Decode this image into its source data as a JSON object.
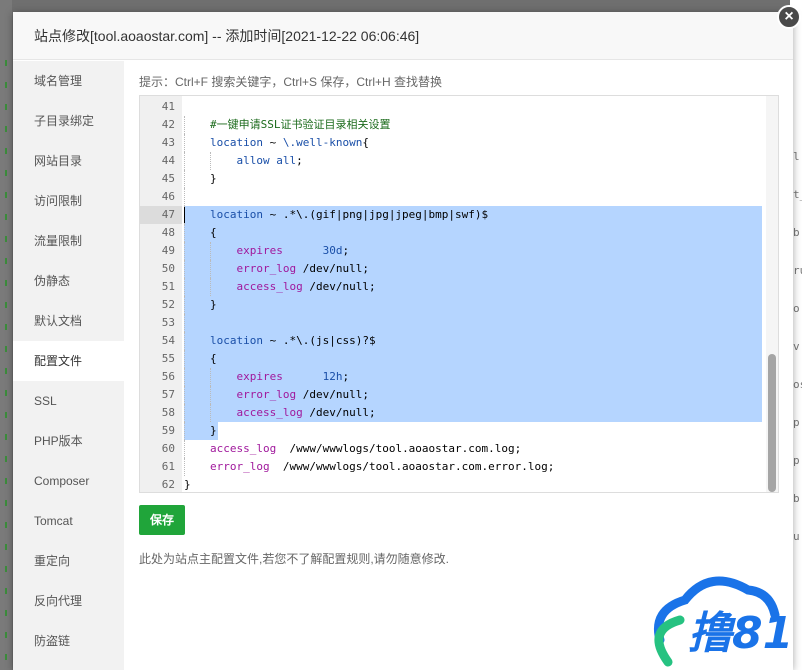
{
  "dialog": {
    "title": "站点修改[tool.aoaostar.com] -- 添加时间[2021-12-22 06:06:46]",
    "close_label": "×"
  },
  "sidebar": {
    "items": [
      {
        "label": "域名管理",
        "active": false
      },
      {
        "label": "子目录绑定",
        "active": false
      },
      {
        "label": "网站目录",
        "active": false
      },
      {
        "label": "访问限制",
        "active": false
      },
      {
        "label": "流量限制",
        "active": false
      },
      {
        "label": "伪静态",
        "active": false
      },
      {
        "label": "默认文档",
        "active": false
      },
      {
        "label": "配置文件",
        "active": true
      },
      {
        "label": "SSL",
        "active": false
      },
      {
        "label": "PHP版本",
        "active": false
      },
      {
        "label": "Composer",
        "active": false
      },
      {
        "label": "Tomcat",
        "active": false
      },
      {
        "label": "重定向",
        "active": false
      },
      {
        "label": "反向代理",
        "active": false
      },
      {
        "label": "防盗链",
        "active": false
      }
    ]
  },
  "editor": {
    "hint": "提示：Ctrl+F 搜索关键字，Ctrl+S 保存，Ctrl+H 查找替换",
    "current_line": 47,
    "selection": {
      "from": 47,
      "to": 59
    },
    "lines": [
      {
        "n": "41",
        "text": ""
      },
      {
        "n": "42",
        "text": "#一键申请SSL证书验证目录相关设置"
      },
      {
        "n": "43",
        "text": "location ~ \\.well-known{"
      },
      {
        "n": "44",
        "text": "    allow all;"
      },
      {
        "n": "45",
        "text": "}"
      },
      {
        "n": "46",
        "text": ""
      },
      {
        "n": "47",
        "text": "location ~ .*\\.(gif|png|jpg|jpeg|bmp|swf)$"
      },
      {
        "n": "48",
        "text": "{"
      },
      {
        "n": "49",
        "text": "    expires      30d;"
      },
      {
        "n": "50",
        "text": "    error_log /dev/null;"
      },
      {
        "n": "51",
        "text": "    access_log /dev/null;"
      },
      {
        "n": "52",
        "text": "}"
      },
      {
        "n": "53",
        "text": ""
      },
      {
        "n": "54",
        "text": "location ~ .*\\.(js|css)?$"
      },
      {
        "n": "55",
        "text": "{"
      },
      {
        "n": "56",
        "text": "    expires      12h;"
      },
      {
        "n": "57",
        "text": "    error_log /dev/null;"
      },
      {
        "n": "58",
        "text": "    access_log /dev/null;"
      },
      {
        "n": "59",
        "text": "}"
      },
      {
        "n": "60",
        "text": "access_log  /www/wwwlogs/tool.aoaostar.com.log;"
      },
      {
        "n": "61",
        "text": "error_log  /www/wwwlogs/tool.aoaostar.com.error.log;"
      },
      {
        "n": "62",
        "text": "}"
      }
    ]
  },
  "save_label": "保存",
  "note": "此处为站点主配置文件,若您不了解配置规则,请勿随意修改.",
  "watermark": {
    "text": "撸81",
    "color": "#1a73e8",
    "accent": "#26c281"
  },
  "background_fragments": [
    "l",
    "t_",
    "b",
    "ru",
    "o",
    "v",
    "os",
    "p",
    "p",
    "b",
    "u"
  ],
  "colors": {
    "accent": "#20a53a",
    "selection": "#b5d5ff"
  }
}
